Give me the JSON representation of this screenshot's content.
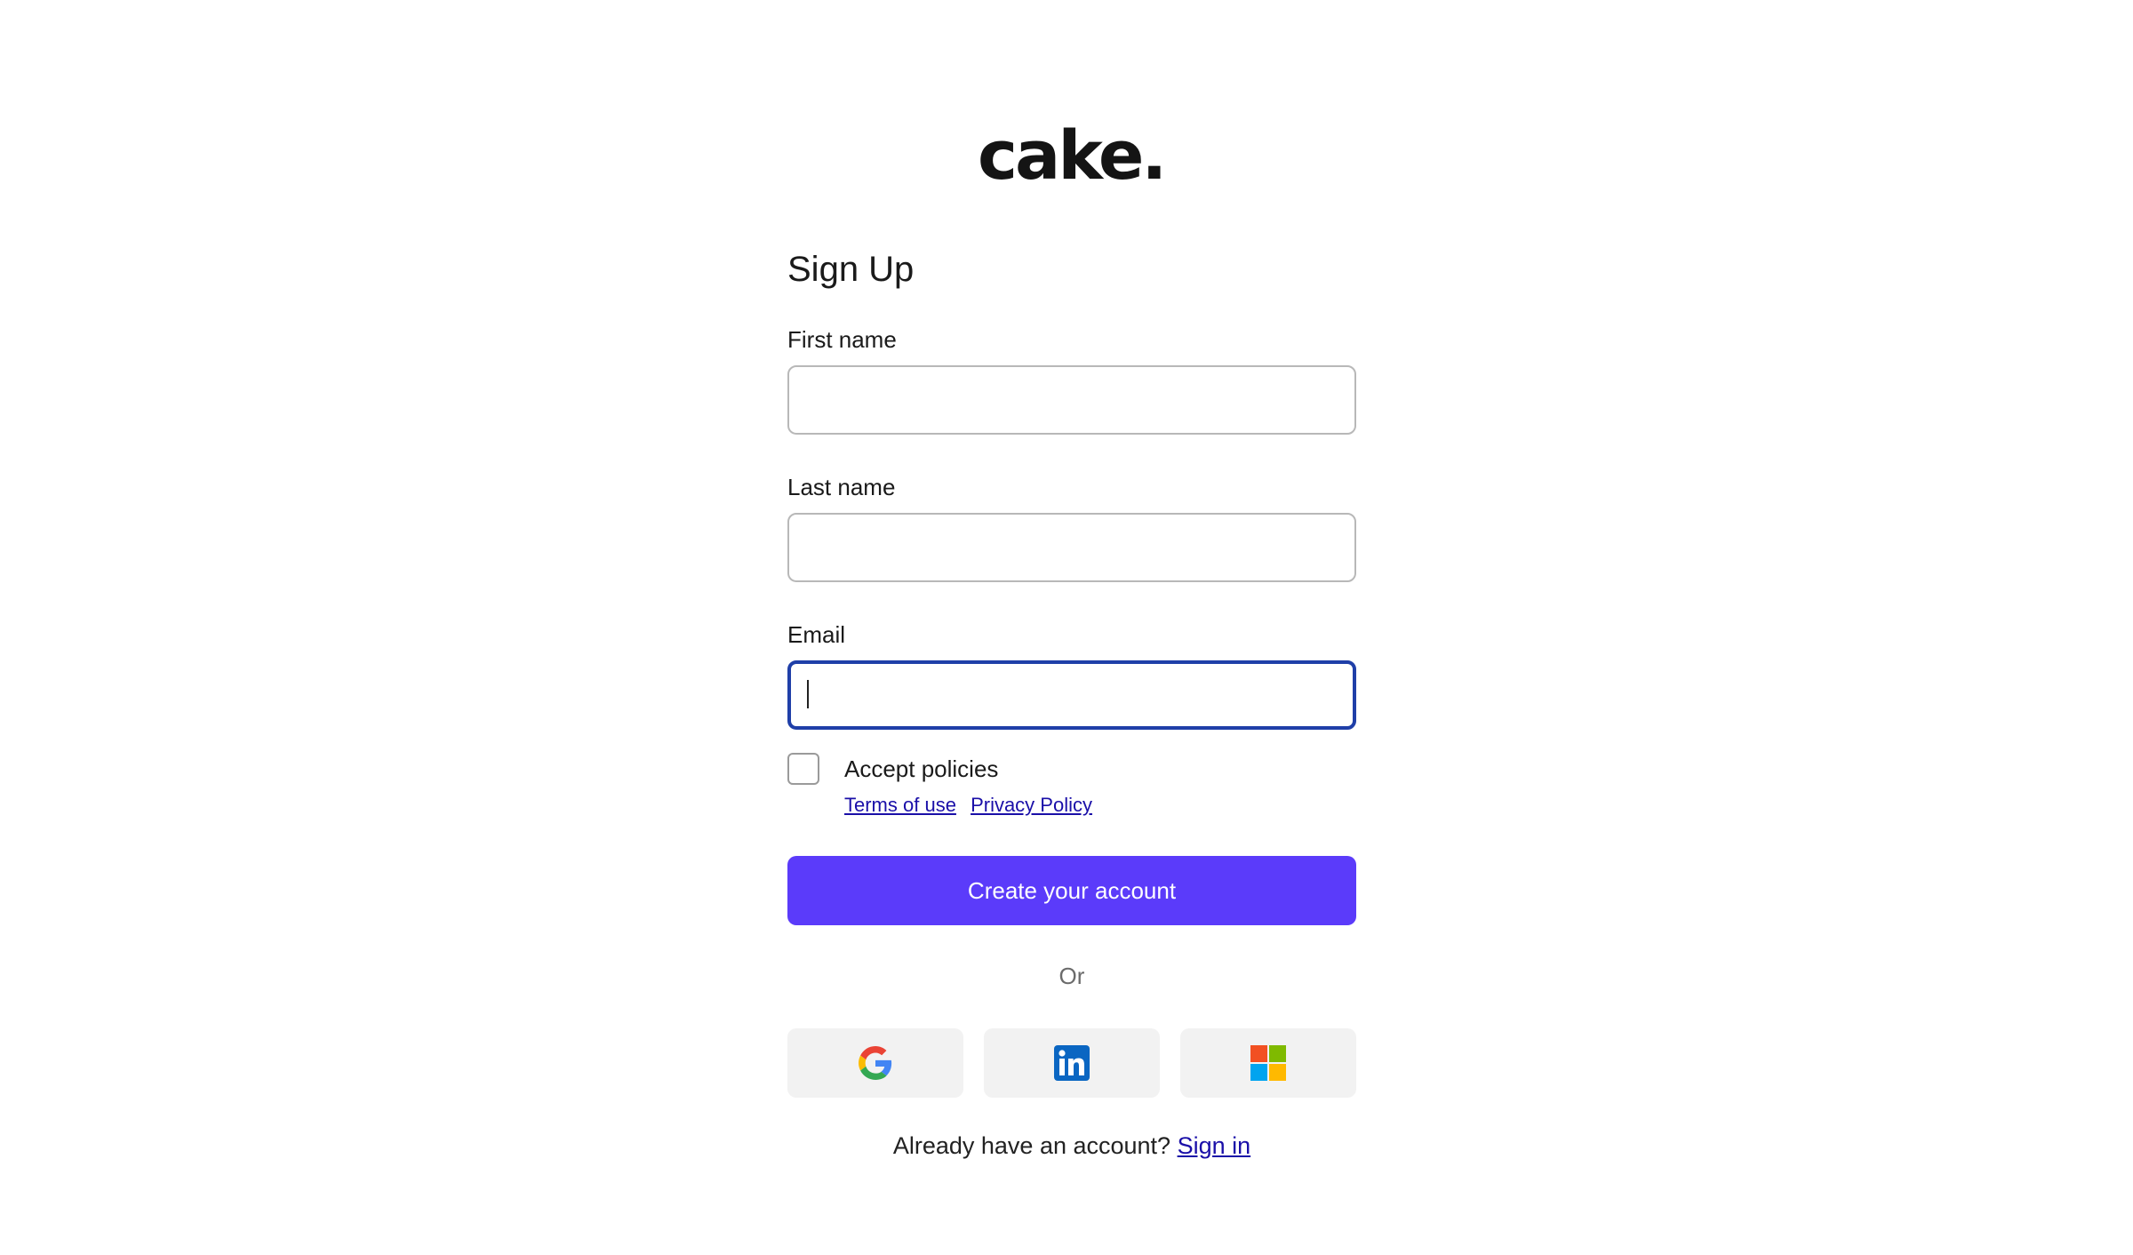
{
  "brand": {
    "logo_text": "cake."
  },
  "form": {
    "title": "Sign Up",
    "first_name": {
      "label": "First name",
      "value": ""
    },
    "last_name": {
      "label": "Last name",
      "value": ""
    },
    "email": {
      "label": "Email",
      "value": "",
      "focused": true
    },
    "policies": {
      "label": "Accept policies",
      "checked": false,
      "terms_link": "Terms of use",
      "privacy_link": "Privacy Policy"
    },
    "submit_label": "Create your account",
    "divider_text": "Or",
    "social": [
      {
        "provider": "google",
        "icon": "google-icon"
      },
      {
        "provider": "linkedin",
        "icon": "linkedin-icon"
      },
      {
        "provider": "microsoft",
        "icon": "microsoft-icon"
      }
    ],
    "signin_prompt": "Already have an account?",
    "signin_link": "Sign in"
  },
  "colors": {
    "primary": "#5b3bfa",
    "link": "#1a0fa8",
    "focus_border": "#1f3fa8",
    "social_bg": "#f2f2f2"
  }
}
